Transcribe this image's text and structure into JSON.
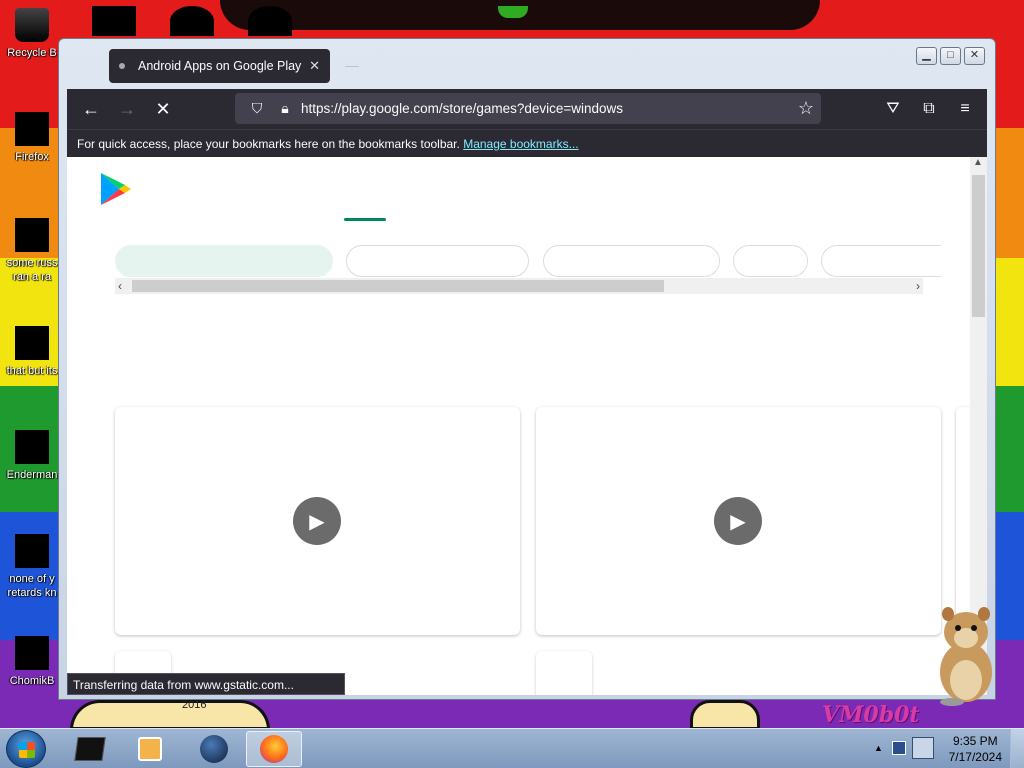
{
  "desktop": {
    "icons": [
      {
        "label": "Recycle B"
      },
      {
        "label": "Firefox"
      },
      {
        "label": "some russ",
        "label2": "ran a ra"
      },
      {
        "label": "that but its"
      },
      {
        "label": "Enderman"
      },
      {
        "label": "none of y",
        "label2": "retards kn"
      },
      {
        "label": "ChomikB"
      }
    ],
    "wallpaper_text": "VM0b0t",
    "wallpaper_year": "2016"
  },
  "browser": {
    "tab_title": "Android Apps on Google Play",
    "url": "https://play.google.com/store/games?device=windows",
    "bookmarks_hint": "For quick access, place your bookmarks here on the bookmarks toolbar.",
    "bookmarks_link": "Manage bookmarks...",
    "status_text": "Transferring data from www.gstatic.com..."
  },
  "taskbar": {
    "time": "9:35 PM",
    "date": "7/17/2024"
  },
  "colors": {
    "browser_chrome": "#2b2a33",
    "urlbar": "#42414d",
    "play_green": "#01875f",
    "chip_active": "#e6f4ef"
  }
}
